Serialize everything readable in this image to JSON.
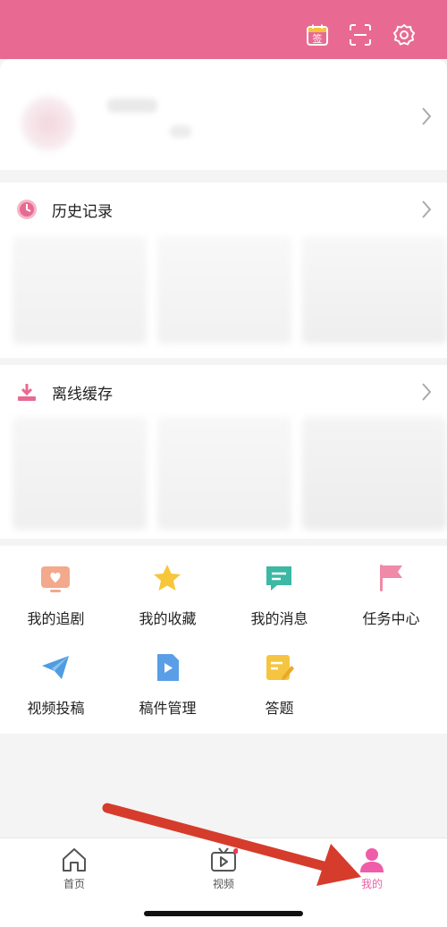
{
  "header": {
    "checkin_icon": "checkin-calendar-icon",
    "checkin_glyph": "签",
    "scan_icon": "scan-icon",
    "settings_icon": "gear-icon",
    "background": "#e86a92"
  },
  "history": {
    "title": "历史记录"
  },
  "offline": {
    "title": "离线缓存"
  },
  "grid": [
    {
      "label": "我的追剧"
    },
    {
      "label": "我的收藏"
    },
    {
      "label": "我的消息"
    },
    {
      "label": "任务中心"
    },
    {
      "label": "视频投稿"
    },
    {
      "label": "稿件管理"
    },
    {
      "label": "答题"
    }
  ],
  "tabbar": {
    "home": "首页",
    "video": "视频",
    "mine": "我的"
  },
  "colors": {
    "accent": "#e86a92",
    "arrow": "#d63c2c"
  }
}
